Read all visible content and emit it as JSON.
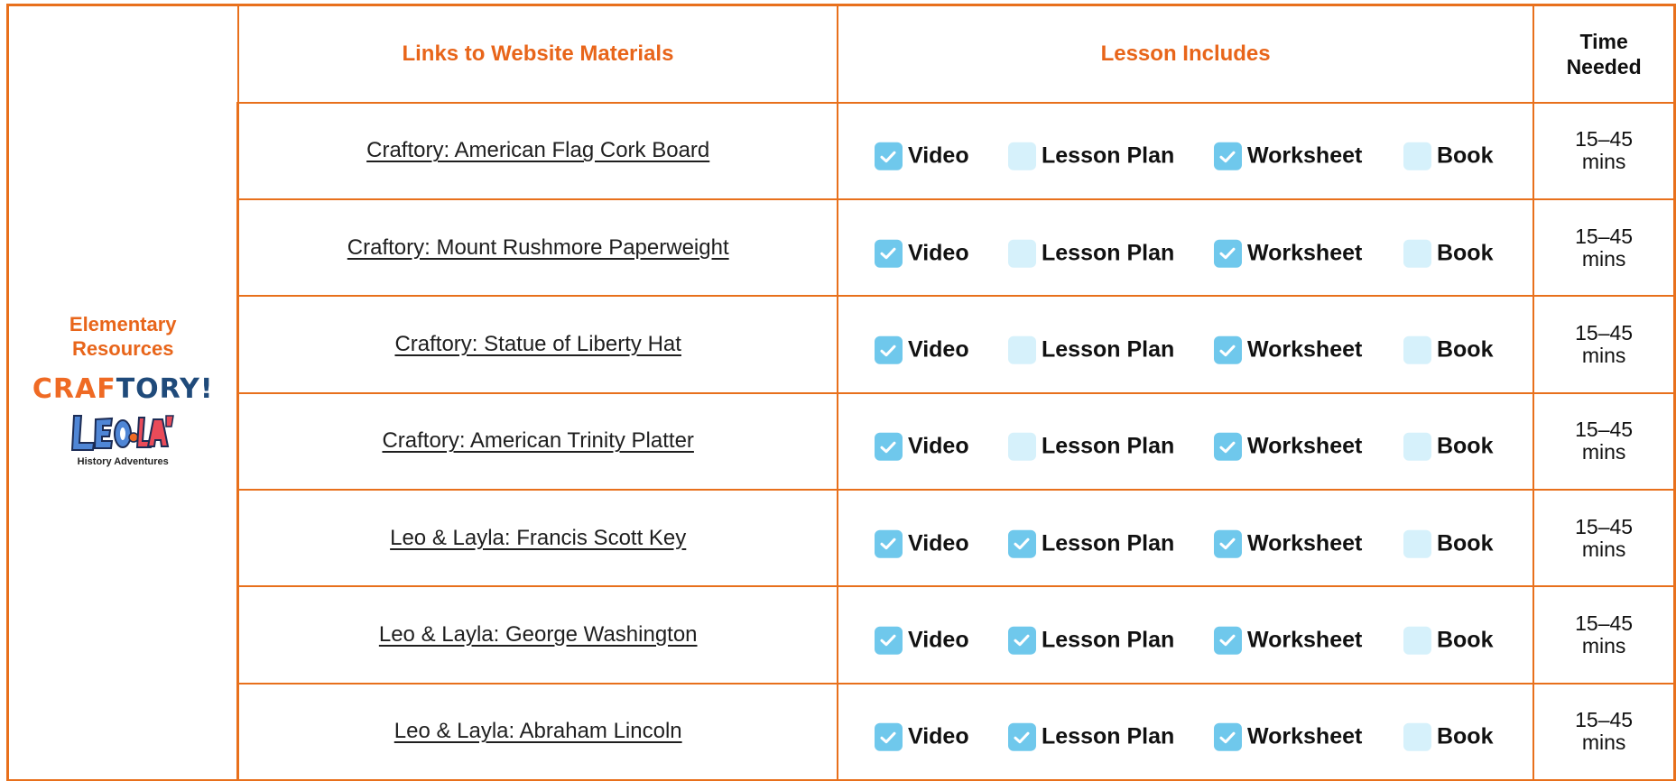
{
  "header": {
    "links_title": "Links to Website Materials",
    "includes_title": "Lesson Includes",
    "time_line1": "Time",
    "time_line2": "Needed"
  },
  "resources": {
    "title_line1": "Elementary",
    "title_line2": "Resources",
    "craftory_logo_a": "CRAF",
    "craftory_logo_b": "TORY!",
    "leo_logo_subtitle": "History Adventures"
  },
  "option_labels": {
    "video": "Video",
    "lesson_plan": "Lesson Plan",
    "worksheet": "Worksheet",
    "book": "Book"
  },
  "rows": [
    {
      "link": "Craftory: American Flag Cork Board",
      "video": true,
      "lesson_plan": false,
      "worksheet": true,
      "book": false,
      "time_line1": "15–45",
      "time_line2": "mins"
    },
    {
      "link": "Craftory: Mount Rushmore Paperweight",
      "video": true,
      "lesson_plan": false,
      "worksheet": true,
      "book": false,
      "time_line1": "15–45",
      "time_line2": "mins"
    },
    {
      "link": "Craftory: Statue of Liberty Hat",
      "video": true,
      "lesson_plan": false,
      "worksheet": true,
      "book": false,
      "time_line1": "15–45",
      "time_line2": "mins"
    },
    {
      "link": "Craftory: American Trinity Platter",
      "video": true,
      "lesson_plan": false,
      "worksheet": true,
      "book": false,
      "time_line1": "15–45",
      "time_line2": "mins"
    },
    {
      "link": "Leo & Layla: Francis Scott Key",
      "video": true,
      "lesson_plan": true,
      "worksheet": true,
      "book": false,
      "time_line1": "15–45",
      "time_line2": "mins"
    },
    {
      "link": "Leo & Layla: George Washington",
      "video": true,
      "lesson_plan": true,
      "worksheet": true,
      "book": false,
      "time_line1": "15–45",
      "time_line2": "mins"
    },
    {
      "link": "Leo & Layla: Abraham Lincoln",
      "video": true,
      "lesson_plan": true,
      "worksheet": true,
      "book": false,
      "time_line1": "15–45",
      "time_line2": "mins"
    }
  ],
  "colors": {
    "border": "#e8701c",
    "heading": "#e8651a",
    "checkbox_checked": "#6fc8ec",
    "checkbox_unchecked": "#d6f1fb"
  },
  "icons": {
    "checked": "check-icon"
  }
}
